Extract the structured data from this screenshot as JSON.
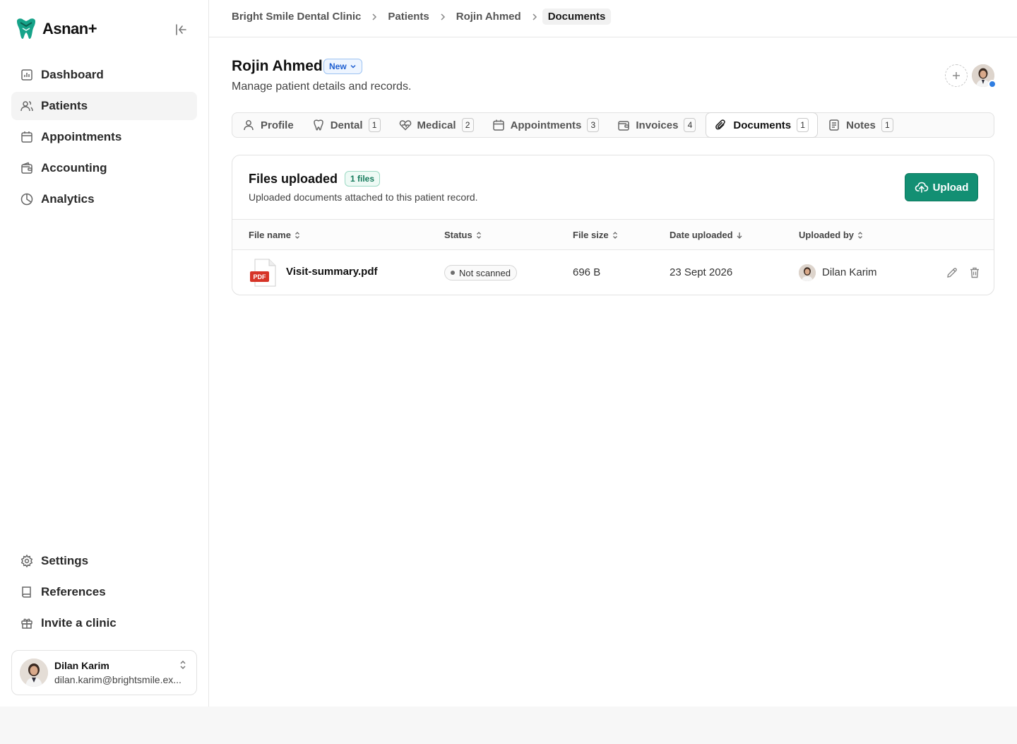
{
  "app": {
    "name": "Asnan+",
    "accent": "#138f73"
  },
  "sidebar": {
    "top_items": [
      {
        "label": "Dashboard",
        "icon": "chart-icon"
      },
      {
        "label": "Patients",
        "icon": "users-icon",
        "active": true
      },
      {
        "label": "Appointments",
        "icon": "calendar-icon"
      },
      {
        "label": "Accounting",
        "icon": "wallet-icon"
      },
      {
        "label": "Analytics",
        "icon": "pie-chart-icon"
      }
    ],
    "bottom_items": [
      {
        "label": "Settings",
        "icon": "gear-icon"
      },
      {
        "label": "References",
        "icon": "book-icon"
      },
      {
        "label": "Invite a clinic",
        "icon": "gift-icon"
      }
    ],
    "user": {
      "name": "Dilan Karim",
      "email": "dilan.karim@brightsmile.ex..."
    }
  },
  "breadcrumb": [
    "Bright Smile Dental Clinic",
    "Patients",
    "Rojin Ahmed",
    "Documents"
  ],
  "patient": {
    "name": "Rojin Ahmed",
    "status": "New",
    "subtitle": "Manage patient details and records."
  },
  "tabs": [
    {
      "label": "Profile",
      "icon": "user-icon",
      "count": ""
    },
    {
      "label": "Dental",
      "icon": "tooth-icon",
      "count": "1"
    },
    {
      "label": "Medical",
      "icon": "heart-pulse-icon",
      "count": "2"
    },
    {
      "label": "Appointments",
      "icon": "calendar-icon",
      "count": "3"
    },
    {
      "label": "Invoices",
      "icon": "wallet-icon",
      "count": "4"
    },
    {
      "label": "Documents",
      "icon": "paperclip-icon",
      "count": "1",
      "active": true
    },
    {
      "label": "Notes",
      "icon": "notes-icon",
      "count": "1"
    }
  ],
  "files": {
    "title": "Files uploaded",
    "count_label": "1 files",
    "description": "Uploaded documents attached to this patient record.",
    "upload_label": "Upload",
    "columns": {
      "name": "File name",
      "status": "Status",
      "size": "File size",
      "date": "Date uploaded",
      "by": "Uploaded by"
    },
    "rows": [
      {
        "name": "Visit-summary.pdf",
        "type_badge": "PDF",
        "status": "Not scanned",
        "size": "696 B",
        "date": "23 Sept 2026",
        "by": "Dilan Karim"
      }
    ]
  }
}
